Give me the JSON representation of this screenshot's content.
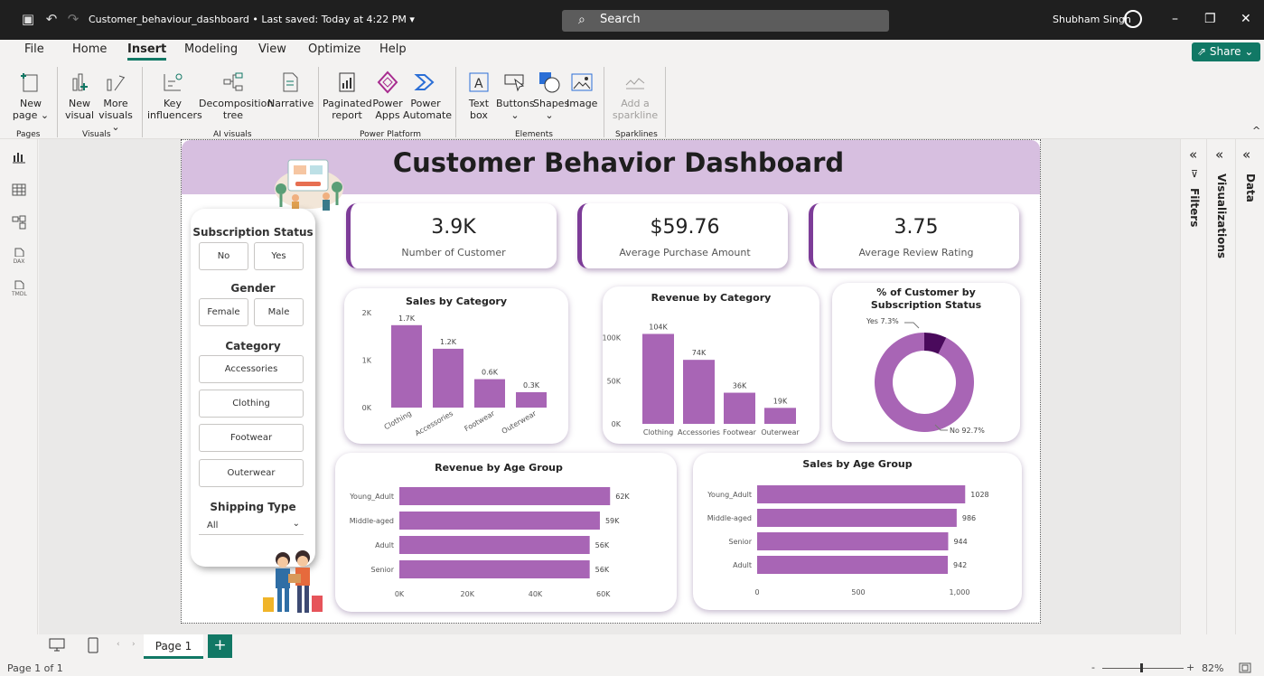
{
  "titlebar": {
    "doc_title": "Customer_behaviour_dashboard • Last saved: Today at 4:22 PM ▾",
    "search_placeholder": "Search",
    "user_name": "Shubham Singh"
  },
  "menu": [
    "File",
    "Home",
    "Insert",
    "Modeling",
    "View",
    "Optimize",
    "Help"
  ],
  "share_label": "Share",
  "ribbon": {
    "new_page": "New\npage ⌄",
    "new_visual": "New\nvisual",
    "more_visuals": "More\nvisuals ⌄",
    "key_influencers": "Key\ninfluencers",
    "decomposition_tree": "Decomposition\ntree",
    "narrative": "Narrative",
    "paginated_report": "Paginated\nreport",
    "power_apps": "Power\nApps",
    "power_automate": "Power\nAutomate",
    "text_box": "Text\nbox",
    "buttons": "Buttons\n⌄",
    "shapes": "Shapes\n⌄",
    "image": "Image",
    "add_sparkline": "Add a\nsparkline",
    "groups": {
      "pages": "Pages",
      "visuals": "Visuals",
      "ai_visuals": "AI visuals",
      "power_platform": "Power Platform",
      "elements": "Elements",
      "sparklines": "Sparklines"
    }
  },
  "left_rail_labels": {
    "dax": "DAX",
    "tmdl": "TMDL"
  },
  "dashboard": {
    "title": "Customer Behavior Dashboard",
    "kpis": [
      {
        "value": "3.9K",
        "label": "Number of Customer"
      },
      {
        "value": "$59.76",
        "label": "Average Purchase Amount"
      },
      {
        "value": "3.75",
        "label": "Average Review Rating"
      }
    ],
    "slicers": {
      "subscription_title": "Subscription Status",
      "subscription_options": [
        "No",
        "Yes"
      ],
      "gender_title": "Gender",
      "gender_options": [
        "Female",
        "Male"
      ],
      "category_title": "Category",
      "category_options": [
        "Accessories",
        "Clothing",
        "Footwear",
        "Outerwear"
      ],
      "shipping_title": "Shipping Type",
      "shipping_value": "All"
    }
  },
  "chart_data": [
    {
      "type": "bar",
      "title": "Sales by Category",
      "categories": [
        "Clothing",
        "Accessories",
        "Footwear",
        "Outerwear"
      ],
      "values": [
        1737,
        1240,
        599,
        324
      ],
      "data_labels": [
        "1.7K",
        "1.2K",
        "0.6K",
        "0.3K"
      ],
      "y_ticks": [
        "0K",
        "1K",
        "2K"
      ],
      "ylim": [
        0,
        2000
      ]
    },
    {
      "type": "bar",
      "title": "Revenue by Category",
      "categories": [
        "Clothing",
        "Accessories",
        "Footwear",
        "Outerwear"
      ],
      "values": [
        104264,
        74200,
        36093,
        18524
      ],
      "data_labels": [
        "104K",
        "74K",
        "36K",
        "19K"
      ],
      "y_ticks": [
        "0K",
        "50K",
        "100K"
      ],
      "ylim": [
        0,
        110000
      ]
    },
    {
      "type": "pie",
      "title": "% of Customer by Subscription Status",
      "slices": [
        {
          "name": "Yes",
          "value": 7.3,
          "label": "Yes 7.3%",
          "color": "#4a0a5c"
        },
        {
          "name": "No",
          "value": 92.7,
          "label": "No 92.7%",
          "color": "#a865b5"
        }
      ]
    },
    {
      "type": "bar",
      "title": "Revenue by Age Group",
      "categories": [
        "Young_Adult",
        "Middle-aged",
        "Adult",
        "Senior"
      ],
      "values": [
        62000,
        59000,
        56000,
        56000
      ],
      "data_labels": [
        "62K",
        "59K",
        "56K",
        "56K"
      ],
      "x_ticks": [
        "0K",
        "20K",
        "40K",
        "60K"
      ],
      "xlim": [
        0,
        63000
      ]
    },
    {
      "type": "bar",
      "title": "Sales by Age Group",
      "categories": [
        "Young_Adult",
        "Middle-aged",
        "Senior",
        "Adult"
      ],
      "values": [
        1028,
        986,
        944,
        942
      ],
      "data_labels": [
        "1028",
        "986",
        "944",
        "942"
      ],
      "x_ticks": [
        "0",
        "500",
        "1,000"
      ],
      "xlim": [
        0,
        1000
      ]
    }
  ],
  "colors": {
    "bar": "#a865b5",
    "accent": "#117865",
    "header": "#d7bfe0"
  },
  "right_panes": {
    "filters": "Filters",
    "visualizations": "Visualizations",
    "data": "Data"
  },
  "pagebar": {
    "page_tab": "Page 1",
    "add": "+"
  },
  "status": {
    "page_info": "Page 1 of 1",
    "zoom": "82%"
  }
}
